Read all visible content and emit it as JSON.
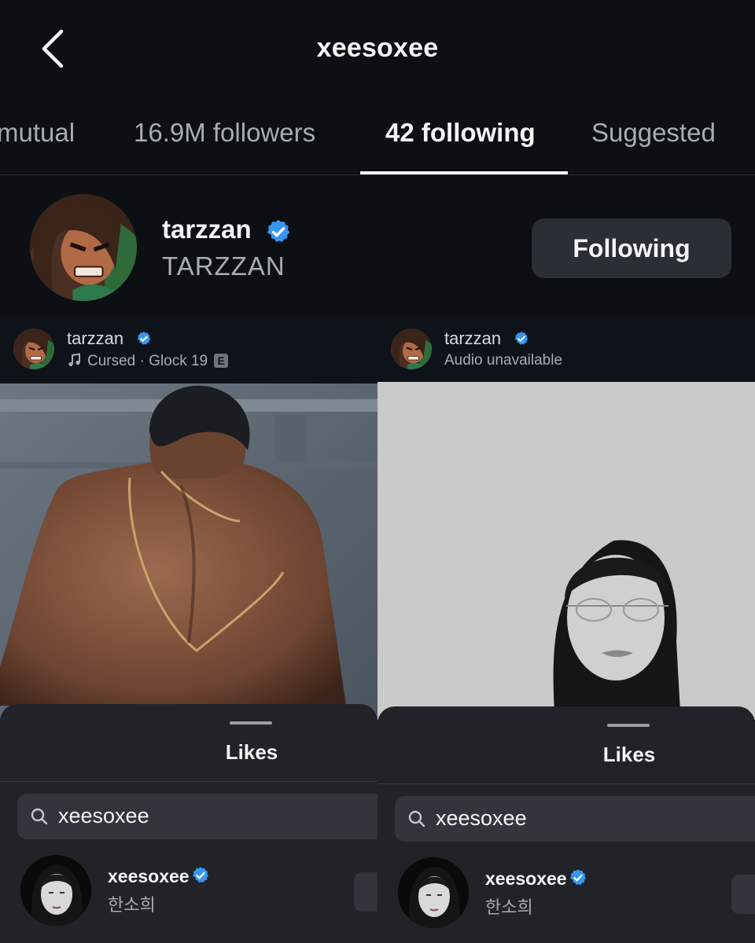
{
  "header": {
    "title": "xeesoxee",
    "back_icon": "chevron-left-icon"
  },
  "tabs": [
    {
      "label": "mutual",
      "active": false
    },
    {
      "label": "16.9M followers",
      "active": false
    },
    {
      "label": "42 following",
      "active": true
    },
    {
      "label": "Suggested",
      "active": false
    }
  ],
  "profile": {
    "username": "tarzzan",
    "full_name": "TARZZAN",
    "verified": true,
    "button_label": "Following"
  },
  "panels": [
    {
      "post": {
        "username": "tarzzan",
        "audio": "Cursed · Glock 19",
        "explicit_badge": "E",
        "audio_icon": "music-note-icon"
      },
      "likes_sheet": {
        "title": "Likes",
        "search_value": "xeesoxee",
        "result": {
          "username": "xeesoxee",
          "name": "한소희",
          "verified": true
        }
      }
    },
    {
      "post": {
        "username": "tarzzan",
        "audio": "Audio unavailable"
      },
      "likes_sheet": {
        "title": "Likes",
        "search_value": "xeesoxee",
        "result": {
          "username": "xeesoxee",
          "name": "한소희",
          "verified": true
        }
      }
    }
  ],
  "colors": {
    "background": "#0c1014",
    "verified_blue": "#3797f0",
    "sheet": "#212328",
    "button": "#2a2e35",
    "muted_text": "#a8adb3"
  }
}
